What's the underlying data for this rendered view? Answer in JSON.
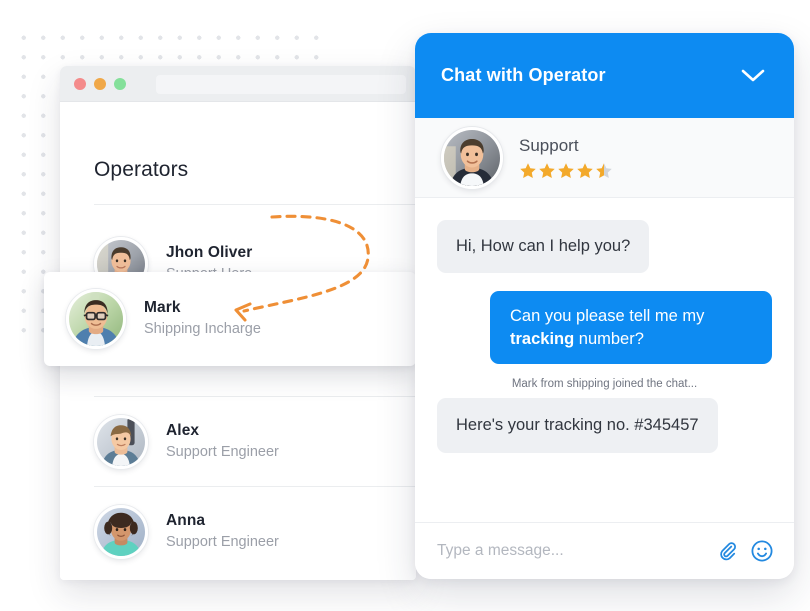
{
  "colors": {
    "accent_blue": "#0d8bf2",
    "bubble_in": "#eef0f3",
    "bubble_out": "#0d8bf2",
    "star_gold": "#f3a92b",
    "star_empty": "#d2d5da",
    "arrow_orange": "#ef8f36",
    "dot_grid": "#e2e4e8",
    "traffic_red": "#f48b8b",
    "traffic_yellow": "#f0a848",
    "traffic_green": "#84e09a"
  },
  "operators_window": {
    "title": "Operators",
    "chrome": {
      "close_dot": "close-dot",
      "minimize_dot": "minimize-dot",
      "maximize_dot": "maximize-dot",
      "urlbar_value": ""
    },
    "list": [
      {
        "name": "Jhon Oliver",
        "role": "Support Hero",
        "avatar": "avatar-jhon"
      },
      {
        "name": "Mark",
        "role": "Shipping Incharge",
        "avatar": "avatar-mark"
      },
      {
        "name": "Alex",
        "role": "Support Engineer",
        "avatar": "avatar-alex"
      },
      {
        "name": "Anna",
        "role": "Support Engineer",
        "avatar": "avatar-anna"
      }
    ]
  },
  "annotation": {
    "arrow": "dashed-curved-arrow",
    "from": "Jhon Oliver",
    "to": "Mark"
  },
  "chat": {
    "header": {
      "title": "Chat with Operator",
      "collapse_icon": "chevron-down-icon"
    },
    "operator": {
      "name": "Support",
      "avatar": "avatar-support",
      "rating": 4.5,
      "stars_total": 5
    },
    "messages": [
      {
        "type": "incoming",
        "text": "Hi, How can I help you?"
      },
      {
        "type": "outgoing",
        "text_before": "Can you please tell me my ",
        "text_bold": "tracking",
        "text_after": " number?"
      },
      {
        "type": "system",
        "text": "Mark from shipping joined the chat..."
      },
      {
        "type": "incoming",
        "text": "Here's your tracking no. #345457"
      }
    ],
    "input": {
      "value": "",
      "placeholder": "Type a message...",
      "attach_icon": "paperclip-icon",
      "emoji_icon": "smiley-icon"
    }
  }
}
